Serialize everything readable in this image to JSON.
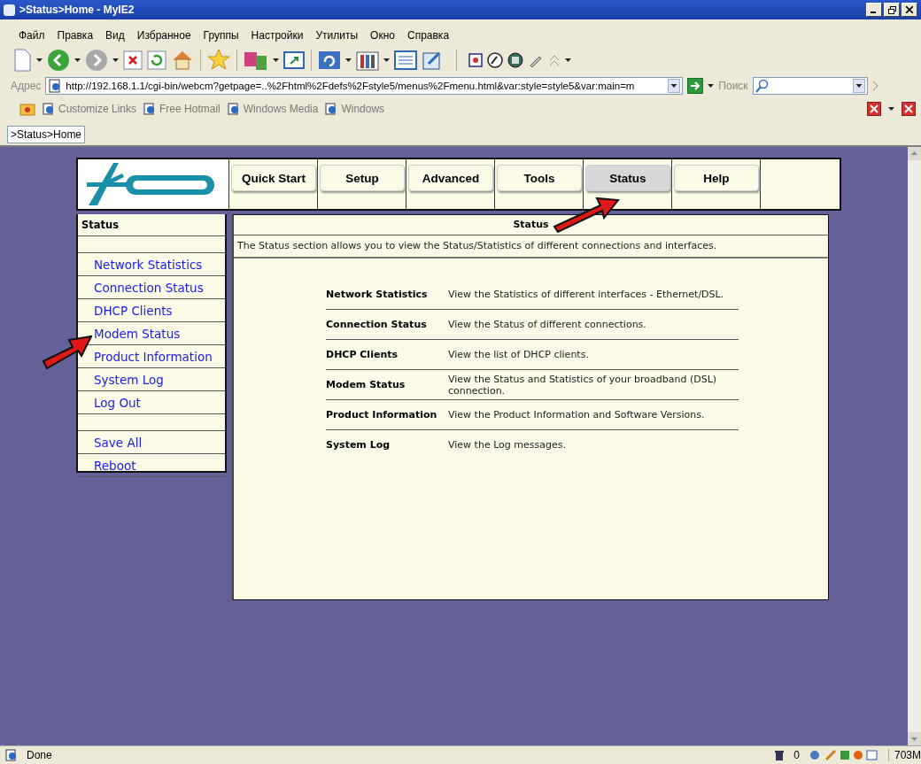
{
  "window": {
    "title": ">Status>Home - MyIE2"
  },
  "menu_bar": [
    "Файл",
    "Правка",
    "Вид",
    "Избранное",
    "Группы",
    "Настройки",
    "Утилиты",
    "Окно",
    "Справка"
  ],
  "address_bar": {
    "label": "Адрес",
    "url": "http://192.168.1.1/cgi-bin/webcm?getpage=..%2Fhtml%2Fdefs%2Fstyle5/menus%2Fmenu.html&var:style=style5&var:main=m"
  },
  "search": {
    "label": "Поиск"
  },
  "links_bar": [
    "Customize Links",
    "Free Hotmail",
    "Windows Media",
    "Windows"
  ],
  "page_tabs": [
    {
      "label": ">Status>Home",
      "selected": true
    }
  ],
  "router": {
    "nav_tabs": [
      {
        "label": "Quick Start",
        "selected": false
      },
      {
        "label": "Setup",
        "selected": false
      },
      {
        "label": "Advanced",
        "selected": false
      },
      {
        "label": "Tools",
        "selected": false
      },
      {
        "label": "Status",
        "selected": true
      },
      {
        "label": "Help",
        "selected": false
      }
    ],
    "sidebar": {
      "title": "Status",
      "groups": [
        {
          "items": [
            "Network Statistics",
            "Connection Status",
            "DHCP Clients",
            "Modem Status",
            "Product Information",
            "System Log",
            "Log Out"
          ]
        },
        {
          "items": [
            "Save All",
            "Reboot"
          ]
        }
      ]
    },
    "content": {
      "title": "Status",
      "intro": "The Status section allows you to view the Status/Statistics of different connections and interfaces.",
      "rows": [
        {
          "name": "Network Statistics",
          "description": "View the Statistics of different interfaces - Ethernet/DSL."
        },
        {
          "name": "Connection Status",
          "description": "View the Status of different connections."
        },
        {
          "name": "DHCP Clients",
          "description": "View the list of DHCP clients."
        },
        {
          "name": "Modem Status",
          "description": "View the Status and Statistics of your broadband (DSL) connection."
        },
        {
          "name": "Product Information",
          "description": "View the Product Information and Software Versions."
        },
        {
          "name": "System Log",
          "description": "View the Log messages."
        }
      ]
    }
  },
  "status_bar": {
    "text": "Done",
    "trash_count": "0",
    "memory": "703M"
  }
}
